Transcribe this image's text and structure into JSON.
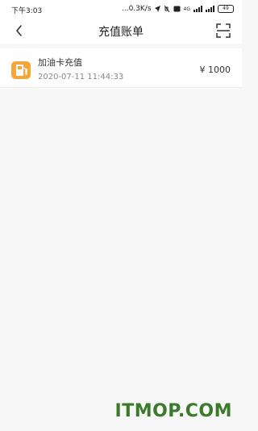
{
  "status_bar": {
    "time": "下午3:03",
    "network_speed": "...0.3K/s",
    "network_label": "4G",
    "battery": "49"
  },
  "header": {
    "title": "充值账单",
    "back_icon": "chevron-left-icon",
    "scan_icon": "scan-icon"
  },
  "bills": [
    {
      "name": "加油卡充值",
      "time": "2020-07-11 11:44:33",
      "amount": "¥ 1000",
      "icon": "fuel-card-icon",
      "icon_color": "#f4a63a"
    }
  ],
  "watermark": "ITMOP.COM"
}
